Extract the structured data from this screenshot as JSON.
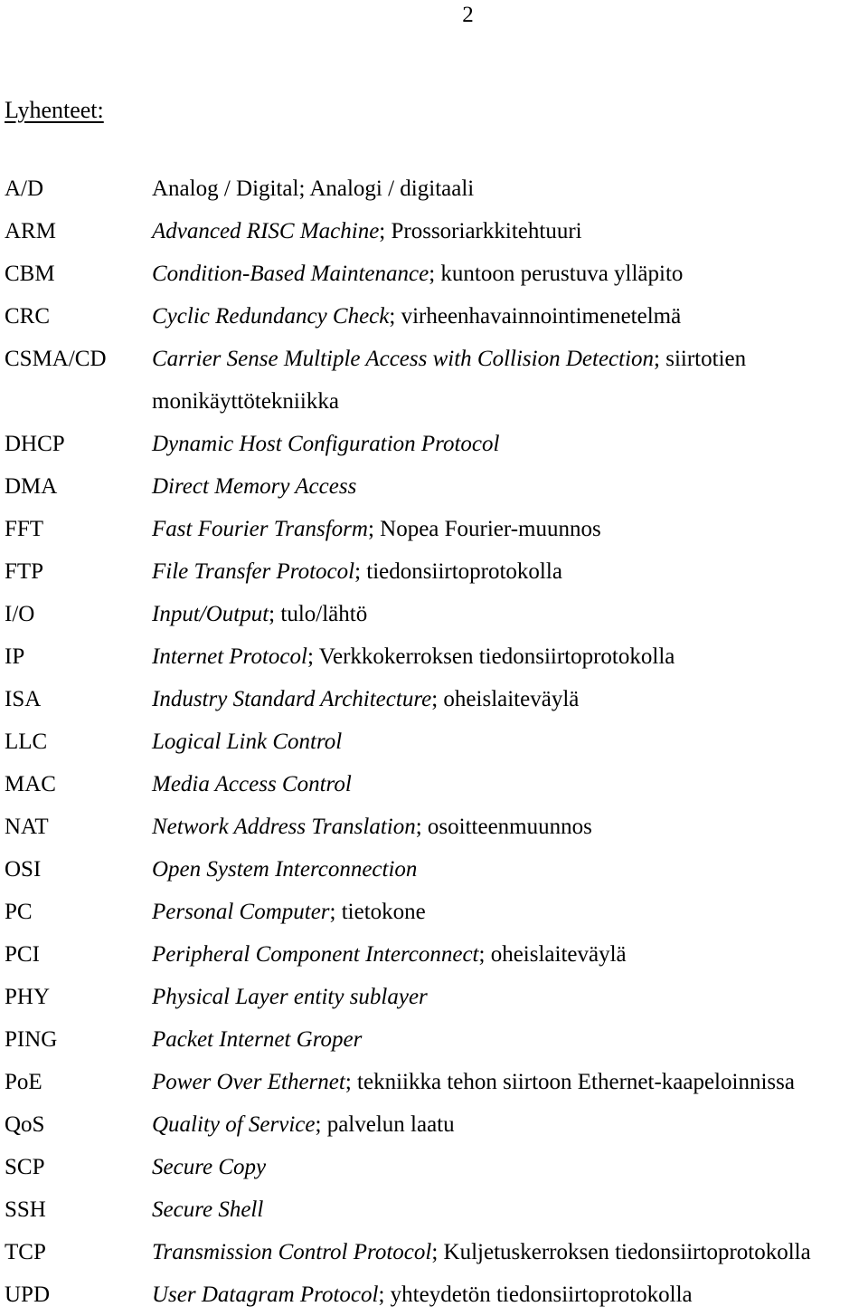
{
  "document": {
    "page_number": "2",
    "heading": "Lyhenteet:"
  },
  "abbreviations": [
    {
      "term": "A/D",
      "english": "Analog / Digital",
      "english_italic": false,
      "separator": "; ",
      "finnish": "Analogi / digitaali",
      "continuation": ""
    },
    {
      "term": "ARM",
      "english": "Advanced RISC Machine",
      "english_italic": true,
      "separator": "; ",
      "finnish": "Prossoriarkkitehtuuri",
      "continuation": ""
    },
    {
      "term": "CBM",
      "english": "Condition-Based Maintenance",
      "english_italic": true,
      "separator": "; ",
      "finnish": "kuntoon perustuva ylläpito",
      "continuation": ""
    },
    {
      "term": "CRC",
      "english": "Cyclic Redundancy Check",
      "english_italic": true,
      "separator": "; ",
      "finnish": "virheenhavainnointimenetelmä",
      "continuation": ""
    },
    {
      "term": "CSMA/CD",
      "english": "Carrier Sense Multiple Access with Collision Detection",
      "english_italic": true,
      "separator": "; ",
      "finnish": "siirtotien",
      "continuation": "monikäyttötekniikka"
    },
    {
      "term": "DHCP",
      "english": "Dynamic Host Configuration Protocol",
      "english_italic": true,
      "separator": "",
      "finnish": "",
      "continuation": ""
    },
    {
      "term": "DMA",
      "english": "Direct Memory Access",
      "english_italic": true,
      "separator": "",
      "finnish": "",
      "continuation": ""
    },
    {
      "term": "FFT",
      "english": "Fast Fourier Transform",
      "english_italic": true,
      "separator": "; ",
      "finnish": "Nopea Fourier-muunnos",
      "continuation": ""
    },
    {
      "term": "FTP",
      "english": "File Transfer Protocol",
      "english_italic": true,
      "separator": "; ",
      "finnish": "tiedonsiirtoprotokolla",
      "continuation": ""
    },
    {
      "term": "I/O",
      "english": "Input/Output",
      "english_italic": true,
      "separator": "; ",
      "finnish": "tulo/lähtö",
      "continuation": ""
    },
    {
      "term": "IP",
      "english": "Internet Protocol",
      "english_italic": true,
      "separator": "; ",
      "finnish": "Verkkokerroksen tiedonsiirtoprotokolla",
      "continuation": ""
    },
    {
      "term": "ISA",
      "english": "Industry Standard Architecture",
      "english_italic": true,
      "separator": "; ",
      "finnish": "oheislaiteväylä",
      "continuation": ""
    },
    {
      "term": "LLC",
      "english": "Logical Link Control",
      "english_italic": true,
      "separator": "",
      "finnish": "",
      "continuation": ""
    },
    {
      "term": "MAC",
      "english": "Media Access Control",
      "english_italic": true,
      "separator": "",
      "finnish": "",
      "continuation": ""
    },
    {
      "term": "NAT",
      "english": "Network Address Translation",
      "english_italic": true,
      "separator": "; ",
      "finnish": "osoitteenmuunnos",
      "continuation": ""
    },
    {
      "term": "OSI",
      "english": "Open System Interconnection",
      "english_italic": true,
      "separator": "",
      "finnish": "",
      "continuation": ""
    },
    {
      "term": "PC",
      "english": "Personal Computer",
      "english_italic": true,
      "separator": "; ",
      "finnish": "tietokone",
      "continuation": ""
    },
    {
      "term": "PCI",
      "english": "Peripheral Component Interconnect",
      "english_italic": true,
      "separator": "; ",
      "finnish": "oheislaiteväylä",
      "continuation": ""
    },
    {
      "term": "PHY",
      "english": "Physical Layer entity sublayer",
      "english_italic": true,
      "separator": "",
      "finnish": "",
      "continuation": ""
    },
    {
      "term": "PING",
      "english": "Packet Internet Groper",
      "english_italic": true,
      "separator": "",
      "finnish": "",
      "continuation": ""
    },
    {
      "term": "PoE",
      "english": "Power Over Ethernet",
      "english_italic": true,
      "separator": "; ",
      "finnish": "tekniikka tehon siirtoon Ethernet-kaapeloinnissa",
      "continuation": ""
    },
    {
      "term": "QoS",
      "english": "Quality of Service",
      "english_italic": true,
      "separator": "; ",
      "finnish": "palvelun laatu",
      "continuation": ""
    },
    {
      "term": "SCP",
      "english": "Secure Copy",
      "english_italic": true,
      "separator": "",
      "finnish": "",
      "continuation": ""
    },
    {
      "term": "SSH",
      "english": "Secure Shell",
      "english_italic": true,
      "separator": "",
      "finnish": "",
      "continuation": ""
    },
    {
      "term": "TCP",
      "english": "Transmission Control Protocol",
      "english_italic": true,
      "separator": "; ",
      "finnish": "Kuljetuskerroksen tiedonsiirtoprotokolla",
      "continuation": ""
    },
    {
      "term": "UPD",
      "english": "User Datagram Protocol",
      "english_italic": true,
      "separator": "; ",
      "finnish": "yhteydetön tiedonsiirtoprotokolla",
      "continuation": ""
    }
  ]
}
